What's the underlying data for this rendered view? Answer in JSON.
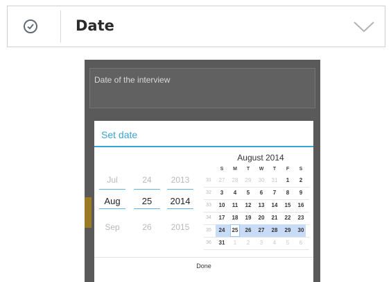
{
  "field": {
    "label": "Date",
    "icon": "clock-icon",
    "dropdown_icon": "chevron-down-icon"
  },
  "question": {
    "text": "Date of the interview"
  },
  "dialog": {
    "title": "Set date",
    "done_label": "Done",
    "accent_color": "#38a7d6",
    "spinners": {
      "month": {
        "prev": "Jul",
        "current": "Aug",
        "next": "Sep"
      },
      "day": {
        "prev": "24",
        "current": "25",
        "next": "26"
      },
      "year": {
        "prev": "2013",
        "current": "2014",
        "next": "2015"
      }
    },
    "calendar": {
      "month_title": "August 2014",
      "weekdays": [
        "S",
        "M",
        "T",
        "W",
        "T",
        "F",
        "S"
      ],
      "weeks": [
        {
          "week": "31",
          "days": [
            "27",
            "28",
            "29",
            "30",
            "31",
            "1",
            "2"
          ],
          "other": [
            true,
            true,
            true,
            true,
            true,
            false,
            false
          ]
        },
        {
          "week": "32",
          "days": [
            "3",
            "4",
            "5",
            "6",
            "7",
            "8",
            "9"
          ],
          "other": [
            false,
            false,
            false,
            false,
            false,
            false,
            false
          ]
        },
        {
          "week": "33",
          "days": [
            "10",
            "11",
            "12",
            "13",
            "14",
            "15",
            "16"
          ],
          "other": [
            false,
            false,
            false,
            false,
            false,
            false,
            false
          ]
        },
        {
          "week": "34",
          "days": [
            "17",
            "18",
            "19",
            "20",
            "21",
            "22",
            "23"
          ],
          "other": [
            false,
            false,
            false,
            false,
            false,
            false,
            false
          ]
        },
        {
          "week": "35",
          "days": [
            "24",
            "25",
            "26",
            "27",
            "28",
            "29",
            "30"
          ],
          "other": [
            false,
            false,
            false,
            false,
            false,
            false,
            false
          ]
        },
        {
          "week": "36",
          "days": [
            "31",
            "1",
            "2",
            "3",
            "4",
            "5",
            "6"
          ],
          "other": [
            false,
            true,
            true,
            true,
            true,
            true,
            true
          ]
        }
      ],
      "selected_day": "25",
      "highlight_week_index": 4
    }
  }
}
